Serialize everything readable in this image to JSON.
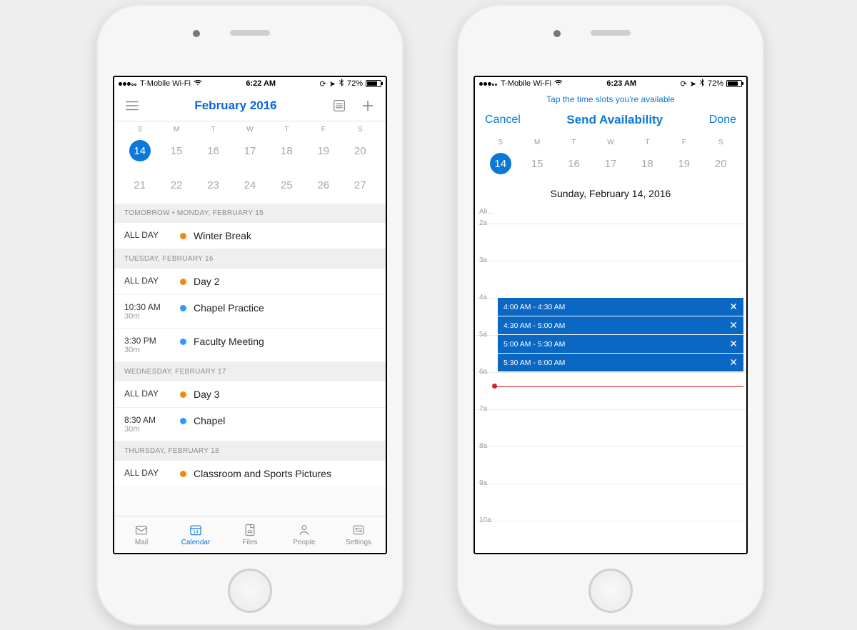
{
  "left": {
    "status": {
      "carrier": "T-Mobile Wi-Fi",
      "time": "6:22 AM",
      "battery_pct": "72%"
    },
    "header": {
      "title": "February 2016"
    },
    "weekdays": [
      "S",
      "M",
      "T",
      "W",
      "T",
      "F",
      "S"
    ],
    "dates": [
      [
        {
          "d": "14",
          "sel": true
        },
        {
          "d": "15"
        },
        {
          "d": "16"
        },
        {
          "d": "17"
        },
        {
          "d": "18"
        },
        {
          "d": "19"
        },
        {
          "d": "20"
        }
      ],
      [
        {
          "d": "21"
        },
        {
          "d": "22"
        },
        {
          "d": "23"
        },
        {
          "d": "24"
        },
        {
          "d": "25"
        },
        {
          "d": "26"
        },
        {
          "d": "27"
        }
      ]
    ],
    "agenda": [
      {
        "header": "TOMORROW • MONDAY, FEBRUARY 15",
        "events": [
          {
            "time": "ALL DAY",
            "dur": "",
            "color": "orange",
            "title": "Winter Break"
          }
        ]
      },
      {
        "header": "TUESDAY, FEBRUARY 16",
        "events": [
          {
            "time": "ALL DAY",
            "dur": "",
            "color": "orange",
            "title": "Day 2"
          },
          {
            "time": "10:30 AM",
            "dur": "30m",
            "color": "blue",
            "title": "Chapel Practice"
          },
          {
            "time": "3:30 PM",
            "dur": "30m",
            "color": "blue",
            "title": "Faculty Meeting"
          }
        ]
      },
      {
        "header": "WEDNESDAY, FEBRUARY 17",
        "events": [
          {
            "time": "ALL DAY",
            "dur": "",
            "color": "orange",
            "title": "Day 3"
          },
          {
            "time": "8:30 AM",
            "dur": "30m",
            "color": "blue",
            "title": "Chapel"
          }
        ]
      },
      {
        "header": "THURSDAY, FEBRUARY 18",
        "events": [
          {
            "time": "ALL DAY",
            "dur": "",
            "color": "orange",
            "title": "Classroom and Sports Pictures"
          }
        ]
      }
    ],
    "tabs": [
      {
        "label": "Mail"
      },
      {
        "label": "Calendar"
      },
      {
        "label": "Files"
      },
      {
        "label": "People"
      },
      {
        "label": "Settings"
      }
    ],
    "active_tab": 1
  },
  "right": {
    "status": {
      "carrier": "T-Mobile Wi-Fi",
      "time": "6:23 AM",
      "battery_pct": "72%"
    },
    "hint": "Tap the time slots you're available",
    "nav": {
      "cancel": "Cancel",
      "title": "Send Availability",
      "done": "Done"
    },
    "weekdays": [
      "S",
      "M",
      "T",
      "W",
      "T",
      "F",
      "S"
    ],
    "dates": [
      {
        "d": "14",
        "sel": true
      },
      {
        "d": "15"
      },
      {
        "d": "16"
      },
      {
        "d": "17"
      },
      {
        "d": "18"
      },
      {
        "d": "19"
      },
      {
        "d": "20"
      }
    ],
    "full_date": "Sunday, February 14, 2016",
    "hours": [
      "All…",
      "2a",
      "3a",
      "4a",
      "5a",
      "6a",
      "7a",
      "8a",
      "9a",
      "10a"
    ],
    "slots": [
      {
        "label": "4:00 AM - 4:30 AM"
      },
      {
        "label": "4:30 AM - 5:00 AM"
      },
      {
        "label": "5:00 AM - 5:30 AM"
      },
      {
        "label": "5:30 AM - 6:00 AM"
      }
    ]
  }
}
